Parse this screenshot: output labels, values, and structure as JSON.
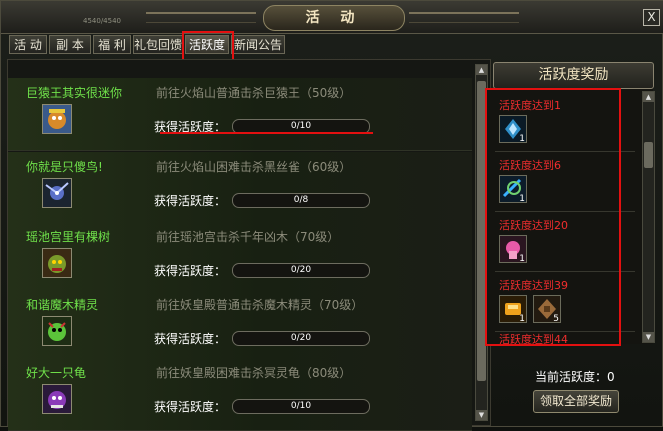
{
  "window": {
    "title": "活 动",
    "close": "X",
    "header_left": "4540/4540"
  },
  "tabs": [
    "活 动",
    "副 本",
    "福 利",
    "礼包回馈",
    "活跃度",
    "新闻公告"
  ],
  "activities": [
    {
      "name": "巨猿王其实很迷你",
      "desc": "前往火焰山普通击杀巨猿王（50级）",
      "gain": "获得活跃度：",
      "progress": "0/10",
      "fill": 0,
      "icon": "monkey-king-icon"
    },
    {
      "name": "你就是只傻鸟!",
      "desc": "前往火焰山困难击杀黑丝雀（60级）",
      "gain": "获得活跃度：",
      "progress": "0/8",
      "fill": 0,
      "icon": "black-bird-icon"
    },
    {
      "name": "瑶池宫里有棵树",
      "desc": "前往瑶池宫击杀千年凶木（70级）",
      "gain": "获得活跃度：",
      "progress": "0/20",
      "fill": 0,
      "icon": "tree-monster-icon"
    },
    {
      "name": "和谐魔木精灵",
      "desc": "前往妖皇殿普通击杀魔木精灵（70级）",
      "gain": "获得活跃度：",
      "progress": "0/20",
      "fill": 0,
      "icon": "wood-spirit-icon"
    },
    {
      "name": "好大一只龟",
      "desc": "前往妖皇殿困难击杀冥灵龟（80级）",
      "gain": "获得活跃度：",
      "progress": "0/10",
      "fill": 0,
      "icon": "turtle-icon"
    }
  ],
  "reward_panel": {
    "title": "活跃度奖励",
    "tiers": [
      {
        "label": "活跃度达到1",
        "items": [
          {
            "icon": "blue-crystal-icon",
            "count": "1"
          }
        ]
      },
      {
        "label": "活跃度达到6",
        "items": [
          {
            "icon": "blue-rune-icon",
            "count": "1"
          }
        ]
      },
      {
        "label": "活跃度达到20",
        "items": [
          {
            "icon": "pink-scroll-icon",
            "count": "1"
          }
        ]
      },
      {
        "label": "活跃度达到39",
        "items": [
          {
            "icon": "gold-ingot-icon",
            "count": "1"
          },
          {
            "icon": "bronze-box-icon",
            "count": "5"
          }
        ]
      },
      {
        "label": "活跃度达到44",
        "items": []
      }
    ],
    "current_label": "当前活跃度：0",
    "claim_button": "领取全部奖励"
  },
  "colors": {
    "highlight": "#e31010",
    "activity_name": "#6fe04a",
    "reward_label": "#ef2d2d"
  }
}
